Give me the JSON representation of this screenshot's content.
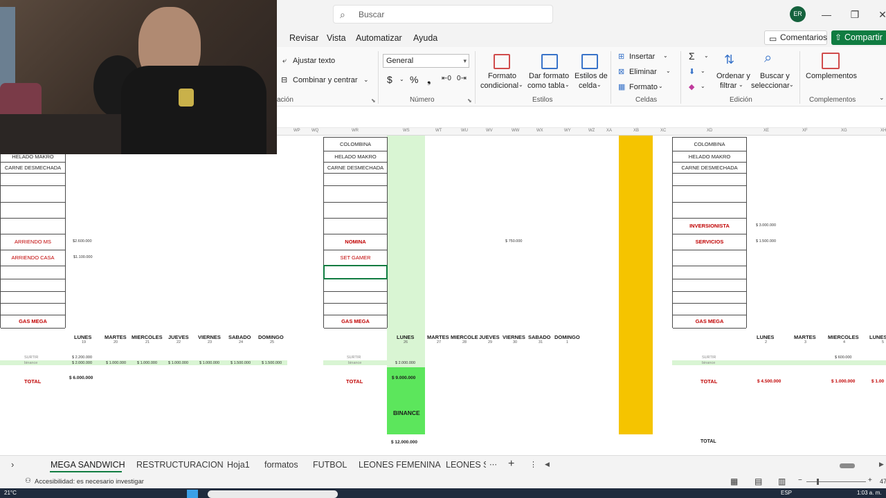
{
  "titlebar": {
    "search_placeholder": "Buscar",
    "avatar_initials": "ER"
  },
  "menu": {
    "items": [
      "Revisar",
      "Vista",
      "Automatizar",
      "Ayuda"
    ],
    "comments_label": "Comentarios",
    "share_label": "Compartir"
  },
  "ribbon": {
    "alignment": {
      "wrap_text": "Ajustar texto",
      "merge_center": "Combinar y centrar",
      "group_label_partial": "ación"
    },
    "number": {
      "format_value": "General",
      "currency": "$",
      "percent": "%",
      "thousands": "❟",
      "group_label": "Número"
    },
    "styles": {
      "conditional_line1": "Formato",
      "conditional_line2": "condicional",
      "table_line1": "Dar formato",
      "table_line2": "como tabla",
      "cell_line1": "Estilos de",
      "cell_line2": "celda",
      "group_label": "Estilos"
    },
    "cells": {
      "insert": "Insertar",
      "delete": "Eliminar",
      "format": "Formato",
      "group_label": "Celdas"
    },
    "editing": {
      "sort_line1": "Ordenar y",
      "sort_line2": "filtrar",
      "find_line1": "Buscar y",
      "find_line2": "seleccionar",
      "group_label": "Edición"
    },
    "addins": {
      "label": "Complementos",
      "group_label": "Complementos"
    }
  },
  "column_headers": [
    "WP",
    "WQ",
    "WR",
    "WS",
    "WT",
    "WU",
    "WV",
    "WW",
    "WX",
    "WY",
    "WZ",
    "XA",
    "XB",
    "XC",
    "XD",
    "XE",
    "XF",
    "XG",
    "XH"
  ],
  "sheet": {
    "block_left": {
      "rows": [
        "HELADO MAKRO",
        "CARNE DESMECHADA",
        "",
        "",
        "",
        "",
        "ARRIENDO MS",
        "ARRIENDO CASA",
        "",
        "",
        "",
        "",
        "GAS MEGA"
      ],
      "values": {
        "arriendo_ms": "$2.600.000",
        "arriendo_casa": "$1.100.000"
      },
      "days": [
        {
          "name": "LUNES",
          "num": "19"
        },
        {
          "name": "MARTES",
          "num": "20"
        },
        {
          "name": "MIERCOLES",
          "num": "21"
        },
        {
          "name": "JUEVES",
          "num": "22"
        },
        {
          "name": "VIERNES",
          "num": "23"
        },
        {
          "name": "SABADO",
          "num": "24"
        },
        {
          "name": "DOMINGO",
          "num": "25"
        }
      ],
      "surtir_label": "SURTIR",
      "surtir_value": "$ 2.200.000",
      "binance_label": "binance",
      "binance_values": [
        "$ 2.000.000",
        "$ 1.000.000",
        "$ 1.000.000",
        "$ 1.000.000",
        "$ 1.000.000",
        "$ 1.500.000",
        "$ 1.500.000"
      ],
      "total_label": "TOTAL",
      "total_value": "$ 6.000.000"
    },
    "block_middle": {
      "rows": [
        "COLOMBINA",
        "HELADO MAKRO",
        "CARNE DESMECHADA",
        "",
        "",
        "",
        "",
        "NOMINA",
        "SET GAMER",
        "",
        "",
        "",
        "",
        "GAS MEGA"
      ],
      "nomina_value": "$ 750.000",
      "days": [
        {
          "name": "LUNES",
          "num": "26"
        },
        {
          "name": "MARTES",
          "num": "27"
        },
        {
          "name": "MIERCOLE",
          "num": "28"
        },
        {
          "name": "JUEVES",
          "num": "29"
        },
        {
          "name": "VIERNES",
          "num": "30"
        },
        {
          "name": "SABADO",
          "num": "31"
        },
        {
          "name": "DOMINGO",
          "num": "1"
        }
      ],
      "surtir_label": "SURTIR",
      "binance_label": "binance",
      "binance_value": "$ 2.000.000",
      "total_label": "TOTAL",
      "total_value": "$ 9.000.000",
      "binance_box": "BINANCE",
      "grand_total": "$ 12.000.000"
    },
    "block_right": {
      "rows": [
        "COLOMBINA",
        "HELADO MAKRO",
        "CARNE DESMECHADA",
        "",
        "",
        "",
        "INVERSIONISTA",
        "SERVICIOS",
        "",
        "",
        "",
        "",
        "",
        "GAS MEGA"
      ],
      "values": {
        "inversionista": "$ 3.000.000",
        "servicios": "$ 1.500.000"
      },
      "days": [
        {
          "name": "LUNES",
          "num": "2"
        },
        {
          "name": "MARTES",
          "num": "3"
        },
        {
          "name": "MIERCOLES",
          "num": "4"
        },
        {
          "name": "LUNES",
          "num": "5"
        }
      ],
      "surtir_label": "SURTIR",
      "surtir_value": "$ 600.000",
      "binance_label": "binance",
      "total_label": "TOTAL",
      "total_values": [
        "$ 4.500.000",
        "$ 1.000.000",
        "$ 1.00"
      ],
      "bottom_total": "TOTAL"
    }
  },
  "tabs": [
    "MEGA SANDWICH",
    "RESTRUCTURACION",
    "Hoja1",
    "formatos",
    "FUTBOL",
    "LEONES FEMENINA",
    "LEONES SU"
  ],
  "status": {
    "accessibility": "Accesibilidad: es necesario investigar",
    "zoom_partial": "47"
  },
  "taskbar": {
    "temperature": "21°C",
    "lang": "ESP",
    "time": "1:03 a. m."
  },
  "colors": {
    "excel_green": "#107c41",
    "highlight_green": "#d9f5d3",
    "binance_green": "#5ce65c",
    "yellow_column": "#f5c400",
    "red_text": "#c00000"
  }
}
